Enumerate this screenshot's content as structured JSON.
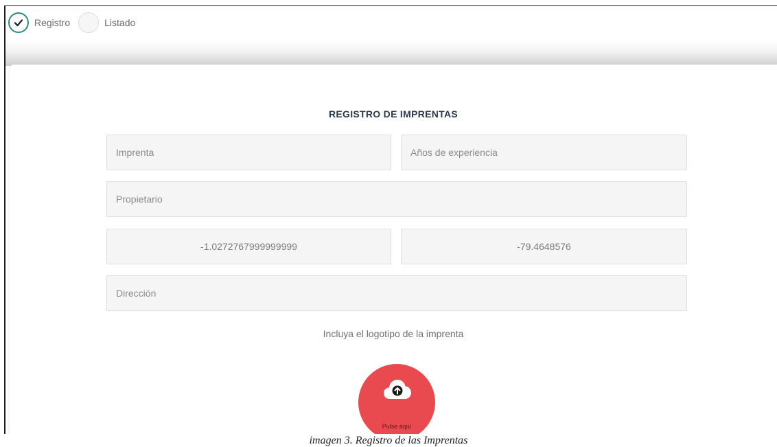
{
  "steps": [
    {
      "label": "Registro",
      "state": "done"
    },
    {
      "label": "Listado",
      "state": "pending"
    }
  ],
  "form": {
    "title": "REGISTRO DE IMPRENTAS",
    "imprenta_placeholder": "Imprenta",
    "experiencia_placeholder": "Años de experiencia",
    "propietario_placeholder": "Propietario",
    "latitud_value": "-1.0272767999999999",
    "longitud_value": "-79.4648576",
    "direccion_placeholder": "Dirección",
    "logo_hint": "Incluya el logotipo de la imprenta",
    "upload_label": "Pulse aquí"
  },
  "caption": "imagen 3. Registro de las Imprentas",
  "colors": {
    "step_done": "#2f8a7e",
    "upload_button": "#e84a50",
    "field_bg": "#f5f5f5"
  },
  "icons": {
    "step_done": "check-icon",
    "upload": "cloud-upload-icon"
  }
}
